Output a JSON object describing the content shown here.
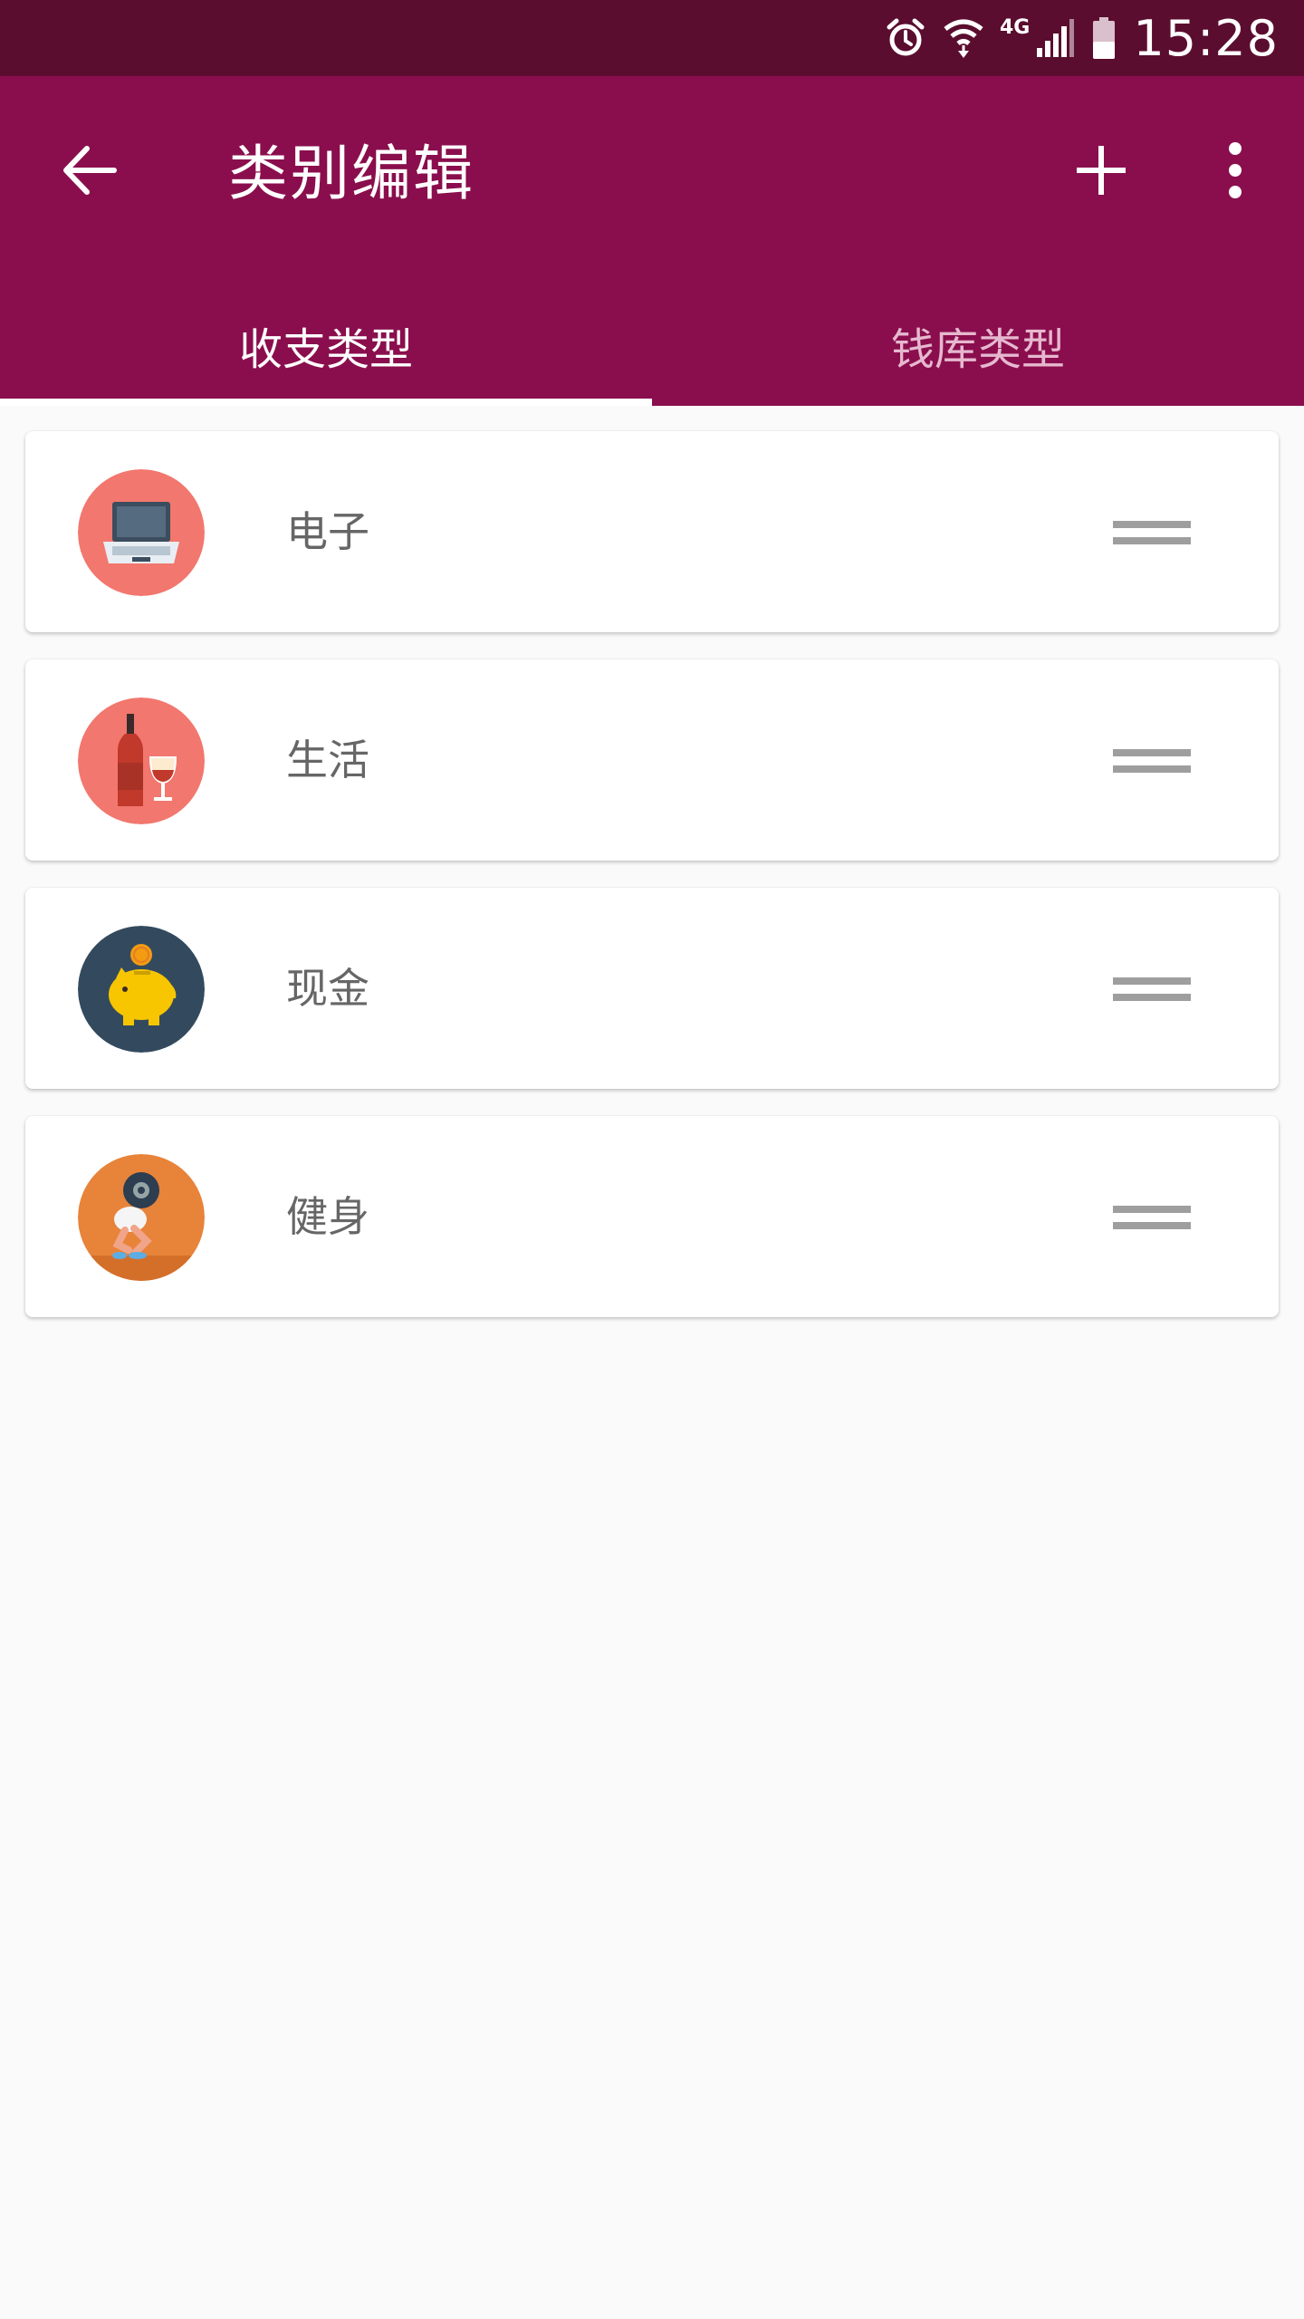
{
  "status_bar": {
    "time": "15:28",
    "network_label": "4G",
    "icons": [
      "alarm-icon",
      "wifi-icon",
      "signal-icon",
      "battery-icon"
    ],
    "background": "#5b0d2f"
  },
  "app_bar": {
    "title": "类别编辑",
    "background": "#8a0e4d",
    "icons": [
      "back-arrow-icon",
      "add-icon",
      "more-vert-icon"
    ]
  },
  "tabs": [
    {
      "label": "收支类型",
      "selected": true
    },
    {
      "label": "钱库类型",
      "selected": false
    }
  ],
  "categories": [
    {
      "label": "电子",
      "icon": "laptop-icon",
      "icon_bg": "#f2776e"
    },
    {
      "label": "生活",
      "icon": "wine-icon",
      "icon_bg": "#f2776e"
    },
    {
      "label": "现金",
      "icon": "piggy-bank-icon",
      "icon_bg": "#334a5e"
    },
    {
      "label": "健身",
      "icon": "fitness-icon",
      "icon_bg": "#e8833a"
    }
  ]
}
